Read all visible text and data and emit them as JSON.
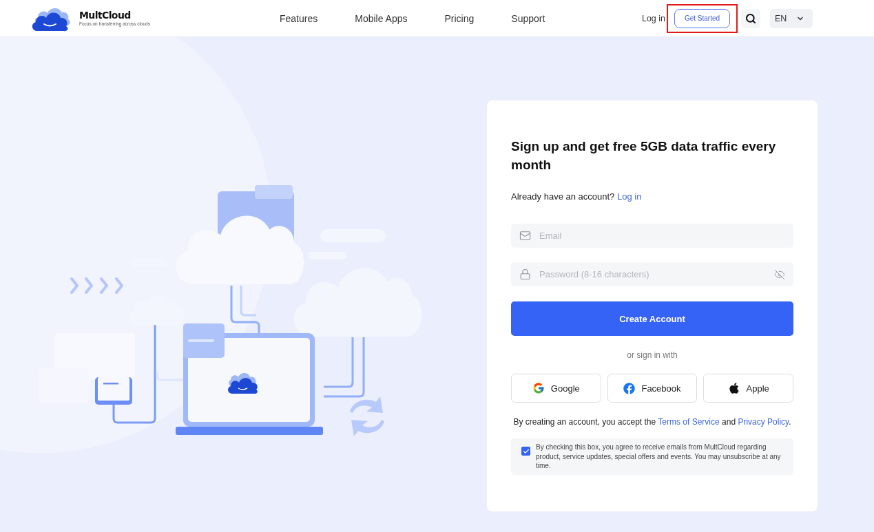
{
  "header": {
    "brand": {
      "name": "MultCloud",
      "tagline": "Focus on transferring across clouds"
    },
    "nav_links": [
      "Features",
      "Mobile Apps",
      "Pricing",
      "Support"
    ],
    "login_link": "Log in",
    "get_started": {
      "label": "Get Started",
      "highlighted": true
    },
    "language": "EN"
  },
  "signup": {
    "title": "Sign up and get free 5GB data traffic every month",
    "account_prompt": "Already have an account?",
    "login_link": "Log in",
    "fields": [
      {
        "kind": "email",
        "placeholder": "Email"
      },
      {
        "kind": "password",
        "placeholder": "Password (8-16 characters)"
      }
    ],
    "submit": "Create Account",
    "divider": "or sign in with",
    "social": [
      {
        "kind": "google",
        "label": "Google"
      },
      {
        "kind": "facebook",
        "label": "Facebook"
      },
      {
        "kind": "apple",
        "label": "Apple"
      }
    ],
    "terms": {
      "prefix": "By creating an account, you accept the",
      "terms_link": "Terms of Service",
      "joiner": "and",
      "privacy_link": "Privacy Policy",
      "suffix": "."
    },
    "consent": {
      "checked": true,
      "text": "By checking this box, you agree to receive emails from MultCloud regarding product, service updates, special offers and events. You may unsubscribe at any time."
    }
  }
}
